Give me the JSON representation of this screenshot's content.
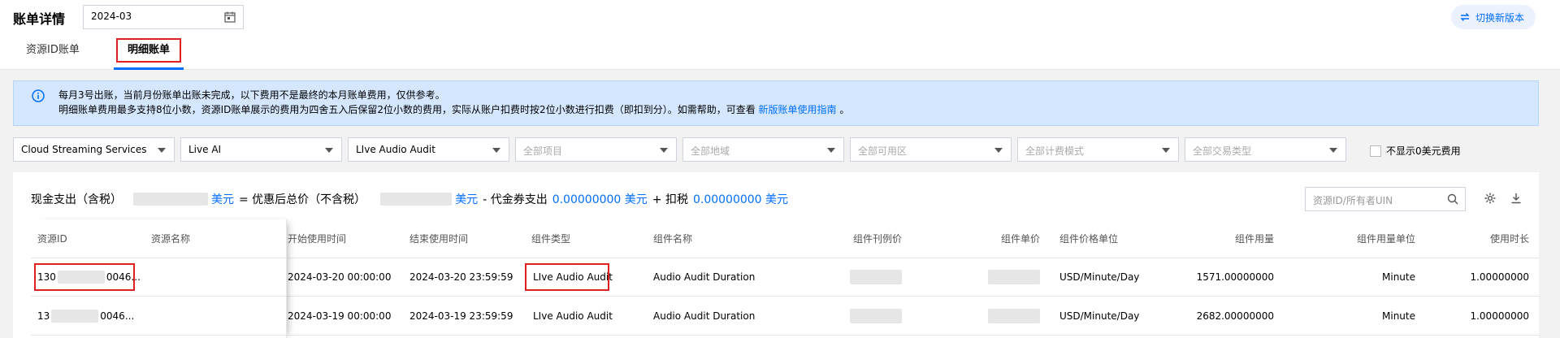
{
  "header": {
    "title": "账单详情",
    "date_value": "2024-03",
    "new_version_label": "切换新版本"
  },
  "tabs": [
    {
      "label": "资源ID账单"
    },
    {
      "label": "明细账单"
    }
  ],
  "notice": {
    "line1": "每月3号出账，当前月份账单出账未完成，以下费用不是最终的本月账单费用，仅供参考。",
    "line2_prefix": "明细账单费用最多支持8位小数，资源ID账单展示的费用为四舍五入后保留2位小数的费用，实际从账户扣费时按2位小数进行扣费（即扣到分）。如需帮助，可查看",
    "guide_link": "新版账单使用指南",
    "line2_suffix": "。"
  },
  "filters": [
    {
      "value": "Cloud Streaming Services",
      "placeholder": false
    },
    {
      "value": "Live AI",
      "placeholder": false
    },
    {
      "value": "LIve Audio Audit",
      "placeholder": false
    },
    {
      "value": "全部项目",
      "placeholder": true
    },
    {
      "value": "全部地域",
      "placeholder": true
    },
    {
      "value": "全部可用区",
      "placeholder": true
    },
    {
      "value": "全部计费模式",
      "placeholder": true
    },
    {
      "value": "全部交易类型",
      "placeholder": true
    }
  ],
  "zero_fee_label": "不显示0美元费用",
  "summary": {
    "cash_label": "现金支出（含税）",
    "unit1": "美元",
    "discount_label": "= 优惠后总价（不含税）",
    "unit2": "美元",
    "voucher_label": "- 代金券支出",
    "voucher_value": "0.00000000 美元",
    "tax_label": "+ 扣税",
    "tax_value": "0.00000000 美元"
  },
  "search": {
    "placeholder": "资源ID/所有者UIN"
  },
  "table": {
    "columns": [
      "资源ID",
      "资源名称",
      "开始使用时间",
      "结束使用时间",
      "组件类型",
      "组件名称",
      "组件刊例价",
      "组件单价",
      "组件价格单位",
      "组件用量",
      "组件用量单位",
      "使用时长"
    ],
    "rows": [
      {
        "id_prefix": "130",
        "id_suffix": "0046...",
        "name": "",
        "start": "2024-03-20 00:00:00",
        "end": "2024-03-20 23:59:59",
        "component_type": "LIve Audio Audit",
        "component_name": "Audio Audit Duration",
        "price_unit": "USD/Minute/Day",
        "usage": "1571.00000000",
        "usage_unit": "Minute",
        "duration": "1.00000000"
      },
      {
        "id_prefix": "13",
        "id_suffix": "0046...",
        "name": "",
        "start": "2024-03-19 00:00:00",
        "end": "2024-03-19 23:59:59",
        "component_type": "LIve Audio Audit",
        "component_name": "Audio Audit Duration",
        "price_unit": "USD/Minute/Day",
        "usage": "2682.00000000",
        "usage_unit": "Minute",
        "duration": "1.00000000"
      }
    ]
  },
  "colors": {
    "accent": "#006eff",
    "highlight": "#e02020",
    "notice_bg": "#d5e7ff"
  }
}
